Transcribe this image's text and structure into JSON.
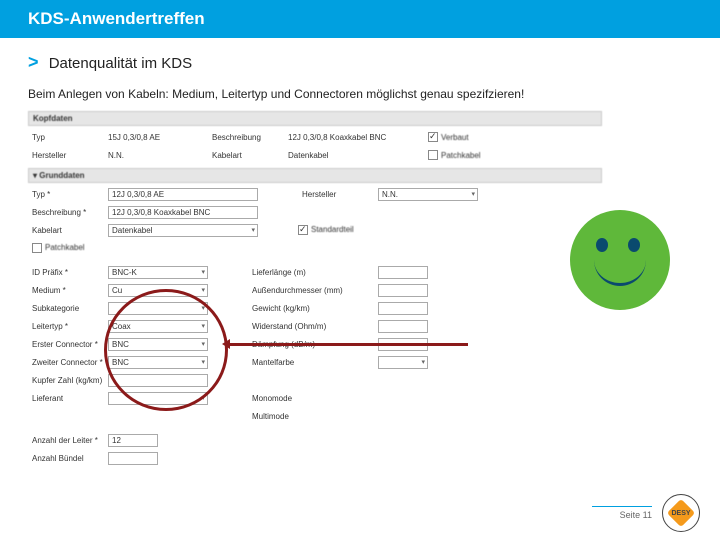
{
  "header": {
    "title": "KDS-Anwendertreffen"
  },
  "section": {
    "prefix": ">",
    "title": "Datenqualität im KDS",
    "description": "Beim Anlegen von Kabeln: Medium, Leitertyp und Connectoren möglichst genau spezifzieren!"
  },
  "form": {
    "kopfdaten_header": "Kopfdaten",
    "r1": {
      "l1": "Typ",
      "v1": "15J 0,3/0,8 AE",
      "l2": "Beschreibung",
      "v2": "12J 0,3/0,8 Koaxkabel BNC",
      "l3": "Verbaut"
    },
    "r2": {
      "l1": "Hersteller",
      "v1": "N.N.",
      "l2": "Kabelart",
      "v2": "Datenkabel",
      "l3": "Patchkabel"
    },
    "grunddaten_header": "▾ Grunddaten",
    "g1": {
      "l1": "Typ *",
      "v1": "12J 0,3/0,8 AE",
      "l2": "Hersteller",
      "v2": "N.N."
    },
    "g2": {
      "l1": "Beschreibung *",
      "v1": "12J 0,3/0,8 Koaxkabel BNC"
    },
    "g3": {
      "l1": "Kabelart",
      "v1": "Datenkabel",
      "l2": "Standardteil"
    },
    "g4": {
      "l1": "Patchkabel"
    },
    "g5": {
      "l1": "ID Präfix *",
      "v1": "BNC-K",
      "l2": "Lieferlänge (m)"
    },
    "g6": {
      "l1": "Medium *",
      "v1": "Cu",
      "l2": "Außendurchmesser (mm)"
    },
    "g7": {
      "l1": "Subkategorie",
      "l2": "Gewicht (kg/km)"
    },
    "g8": {
      "l1": "Leitertyp *",
      "v1": "Coax",
      "l2": "Widerstand (Ohm/m)"
    },
    "g9": {
      "l1": "Erster Connector *",
      "v1": "BNC",
      "l2": "Dämpfung (dB/m)"
    },
    "g10": {
      "l1": "Zweiter Connector *",
      "v1": "BNC",
      "l2": "Mantelfarbe"
    },
    "g11": {
      "l1": "Kupfer Zahl (kg/km)"
    },
    "g12": {
      "l1": "Lieferant",
      "l2": "Monomode"
    },
    "g13": {
      "l2": "Multimode"
    },
    "g14": {
      "l1": "Anzahl der Leiter *",
      "v1": "12"
    },
    "g15": {
      "l1": "Anzahl Bündel"
    }
  },
  "footer": {
    "page": "Seite 11",
    "logo": "DESY"
  }
}
